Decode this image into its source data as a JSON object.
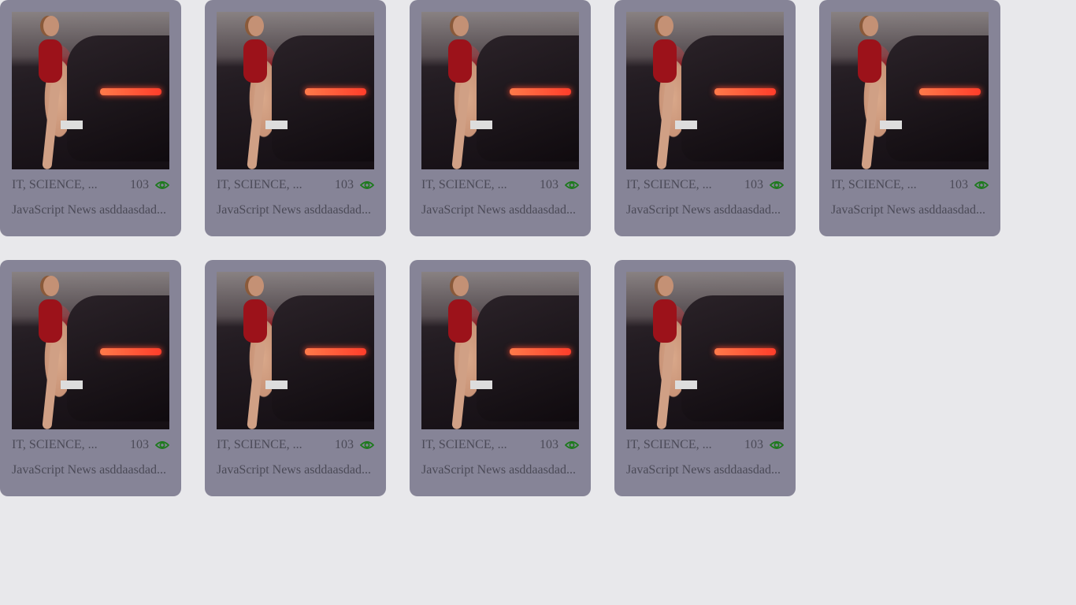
{
  "colors": {
    "card": "#868497",
    "page": "#e8e8eb",
    "eye": "#1e7a1e",
    "text": "#4b4a57"
  },
  "cards": [
    {
      "categories": "IT, SCIENCE, ...",
      "views": "103",
      "title": "JavaScript News asddaasdad..."
    },
    {
      "categories": "IT, SCIENCE, ...",
      "views": "103",
      "title": "JavaScript News asddaasdad..."
    },
    {
      "categories": "IT, SCIENCE, ...",
      "views": "103",
      "title": "JavaScript News asddaasdad..."
    },
    {
      "categories": "IT, SCIENCE, ...",
      "views": "103",
      "title": "JavaScript News asddaasdad..."
    },
    {
      "categories": "IT, SCIENCE, ...",
      "views": "103",
      "title": "JavaScript News asddaasdad..."
    },
    {
      "categories": "IT, SCIENCE, ...",
      "views": "103",
      "title": "JavaScript News asddaasdad..."
    },
    {
      "categories": "IT, SCIENCE, ...",
      "views": "103",
      "title": "JavaScript News asddaasdad..."
    },
    {
      "categories": "IT, SCIENCE, ...",
      "views": "103",
      "title": "JavaScript News asddaasdad..."
    },
    {
      "categories": "IT, SCIENCE, ...",
      "views": "103",
      "title": "JavaScript News asddaasdad..."
    }
  ]
}
